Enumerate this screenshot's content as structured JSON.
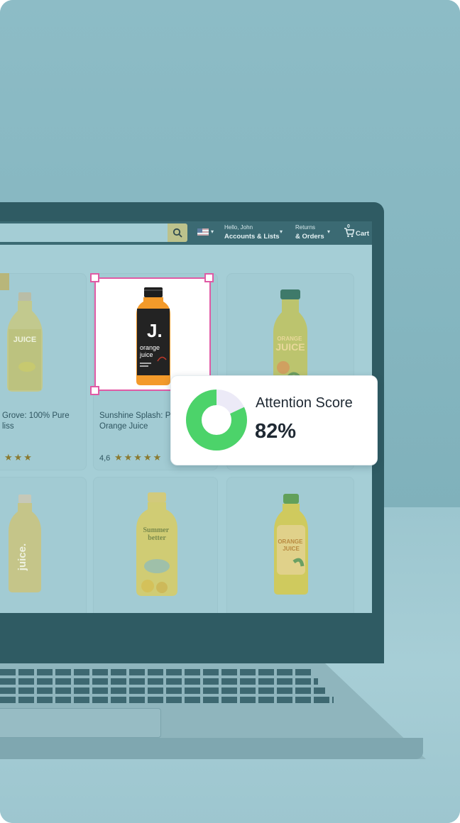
{
  "header": {
    "greeting": "Hello, John",
    "accounts_label": "Accounts & Lists",
    "returns_small": "Returns",
    "orders_label": "& Orders",
    "cart_count": "0",
    "cart_label": "Cart"
  },
  "products": [
    {
      "title": "Grove: 100% Pure\nliss",
      "stars": "★★★",
      "rating": ""
    },
    {
      "title": "Sunshine Splash: P\nOrange Juice",
      "stars": "★★★★★",
      "rating": "4,6"
    },
    {
      "title": "",
      "stars": "",
      "rating": ""
    }
  ],
  "bottle_labels": {
    "juice1": "JUICE",
    "j_brand": "J.",
    "j_line1": "orange",
    "j_line2": "juice",
    "orange_juice": "ORANGE\nJUICE",
    "juice_dot": "juice.",
    "summer_better": "Summer\nbetter"
  },
  "attention": {
    "label": "Attention Score",
    "value": "82%",
    "percent": 82,
    "color_fill": "#4cd36a",
    "color_rest": "#eceaf7"
  },
  "colors": {
    "selection": "#e05aa5",
    "background": "#8cbcc6"
  }
}
